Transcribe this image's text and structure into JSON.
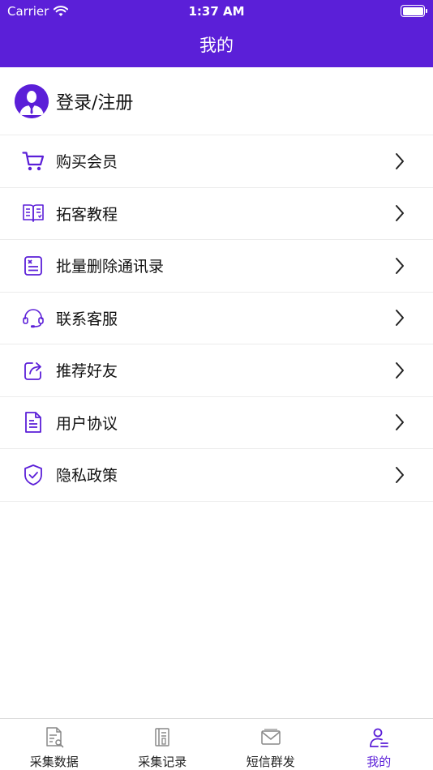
{
  "status_bar": {
    "carrier": "Carrier",
    "time": "1:37 AM"
  },
  "header": {
    "title": "我的"
  },
  "profile": {
    "label": "登录/注册"
  },
  "menu": {
    "items": [
      {
        "label": "购买会员",
        "icon": "cart-icon"
      },
      {
        "label": "拓客教程",
        "icon": "book-icon"
      },
      {
        "label": "批量删除通讯录",
        "icon": "delete-document-icon"
      },
      {
        "label": "联系客服",
        "icon": "headset-icon"
      },
      {
        "label": "推荐好友",
        "icon": "share-icon"
      },
      {
        "label": "用户协议",
        "icon": "document-icon"
      },
      {
        "label": "隐私政策",
        "icon": "shield-icon"
      }
    ]
  },
  "tabbar": {
    "items": [
      {
        "label": "采集数据",
        "icon": "document-search-icon",
        "active": false
      },
      {
        "label": "采集记录",
        "icon": "record-icon",
        "active": false
      },
      {
        "label": "短信群发",
        "icon": "mail-icon",
        "active": false
      },
      {
        "label": "我的",
        "icon": "user-icon",
        "active": true
      }
    ]
  },
  "colors": {
    "accent": "#5b1fd8",
    "divider": "#ececec",
    "text": "#111111"
  }
}
